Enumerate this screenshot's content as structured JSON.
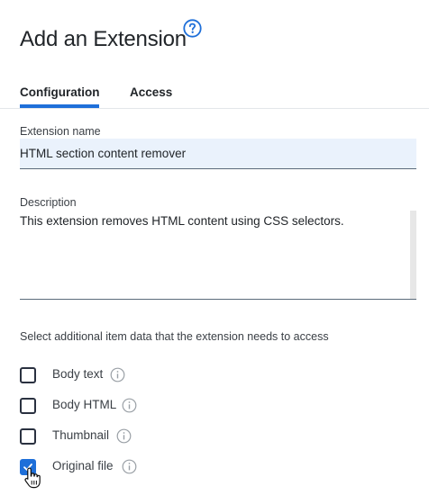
{
  "header": {
    "title": "Add an Extension",
    "help_icon": "question-circle-icon"
  },
  "tabs": [
    {
      "label": "Configuration",
      "active": true
    },
    {
      "label": "Access",
      "active": false
    }
  ],
  "form": {
    "name": {
      "label": "Extension name",
      "value": "HTML section content remover"
    },
    "description": {
      "label": "Description",
      "value": "This extension removes HTML content using CSS selectors."
    }
  },
  "access": {
    "note": "Select additional item data that the extension needs to access",
    "options": [
      {
        "label": "Body text",
        "checked": false,
        "info_icon": "info-circle-icon"
      },
      {
        "label": "Body HTML",
        "checked": false,
        "info_icon": "info-circle-icon"
      },
      {
        "label": "Thumbnail",
        "checked": false,
        "info_icon": "info-circle-icon"
      },
      {
        "label": "Original file",
        "checked": true,
        "info_icon": "info-circle-icon"
      }
    ]
  },
  "colors": {
    "accent": "#1e6fd9",
    "input_background": "#eaf2fc",
    "text": "#212529"
  },
  "cursor": "hand-pointer-icon"
}
